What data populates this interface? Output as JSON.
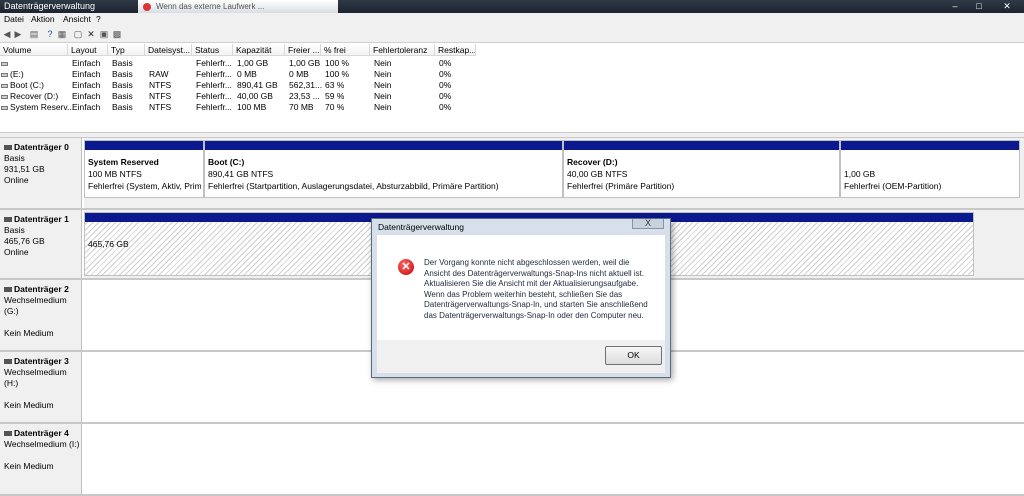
{
  "window": {
    "title": "Datenträgerverwaltung",
    "ghost_tab": "Wenn das externe Laufwerk ..."
  },
  "menu": [
    "Datei",
    "Aktion",
    "Ansicht",
    "?"
  ],
  "toolbar": [
    "back-icon",
    "forward-icon",
    "list-icon",
    "help-icon",
    "list2-icon",
    "properties-icon",
    "delete-icon",
    "check-icon",
    "refresh-icon"
  ],
  "columns": [
    "Volume",
    "Layout",
    "Typ",
    "Dateisyst...",
    "Status",
    "Kapazität",
    "Freier ...",
    "% frei",
    "Fehlertoleranz",
    "Restkap..."
  ],
  "volumes": [
    [
      "",
      "Einfach",
      "Basis",
      "",
      "Fehlerfr...",
      "1,00 GB",
      "1,00 GB",
      "100 %",
      "Nein",
      "0%"
    ],
    [
      "(E:)",
      "Einfach",
      "Basis",
      "RAW",
      "Fehlerfr...",
      "0 MB",
      "0 MB",
      "100 %",
      "Nein",
      "0%"
    ],
    [
      "Boot (C:)",
      "Einfach",
      "Basis",
      "NTFS",
      "Fehlerfr...",
      "890,41 GB",
      "562,31...",
      "63 %",
      "Nein",
      "0%"
    ],
    [
      "Recover (D:)",
      "Einfach",
      "Basis",
      "NTFS",
      "Fehlerfr...",
      "40,00 GB",
      "23,53 ...",
      "59 %",
      "Nein",
      "0%"
    ],
    [
      "System Reserv...",
      "Einfach",
      "Basis",
      "NTFS",
      "Fehlerfr...",
      "100 MB",
      "70 MB",
      "70 %",
      "Nein",
      "0%"
    ]
  ],
  "disks": [
    {
      "name": "Datenträger 0",
      "type": "Basis",
      "size": "931,51 GB",
      "status": "Online",
      "partitions": [
        {
          "name": "System Reserved",
          "size": "100 MB NTFS",
          "status": "Fehlerfrei (System, Aktiv, Primär"
        },
        {
          "name": "Boot  (C:)",
          "size": "890,41 GB NTFS",
          "status": "Fehlerfrei (Startpartition, Auslagerungsdatei, Absturzabbild, Primäre Partition)"
        },
        {
          "name": "Recover  (D:)",
          "size": "40,00 GB NTFS",
          "status": "Fehlerfrei (Primäre Partition)"
        },
        {
          "name": "",
          "size": "1,00 GB",
          "status": "Fehlerfrei (OEM-Partition)"
        }
      ]
    },
    {
      "name": "Datenträger 1",
      "type": "Basis",
      "size": "465,76 GB",
      "status": "Online",
      "partitions": [
        {
          "name": "",
          "size": "465,76 GB",
          "status": ""
        }
      ]
    },
    {
      "name": "Datenträger 2",
      "type": "Wechselmedium (G:)",
      "size": "",
      "status": "Kein Medium"
    },
    {
      "name": "Datenträger 3",
      "type": "Wechselmedium (H:)",
      "size": "",
      "status": "Kein Medium"
    },
    {
      "name": "Datenträger 4",
      "type": "Wechselmedium (I:)",
      "size": "",
      "status": "Kein Medium"
    }
  ],
  "dialog": {
    "title": "Datenträgerverwaltung",
    "close": "X",
    "message": [
      "Der Vorgang konnte nicht abgeschlossen werden, weil die",
      "Ansicht des Datenträgerverwaltungs-Snap-Ins nicht aktuell ist.",
      "Aktualisieren Sie die Ansicht mit der Aktualisierungsaufgabe.",
      "Wenn das Problem weiterhin besteht, schließen Sie das",
      "Datenträgerverwaltungs-Snap-In, und starten Sie anschließend",
      "das Datenträgerverwaltungs-Snap-In oder den Computer neu."
    ],
    "ok": "OK"
  },
  "colors": {
    "partition_bar": "#0a1a8e",
    "error": "#c40000"
  }
}
